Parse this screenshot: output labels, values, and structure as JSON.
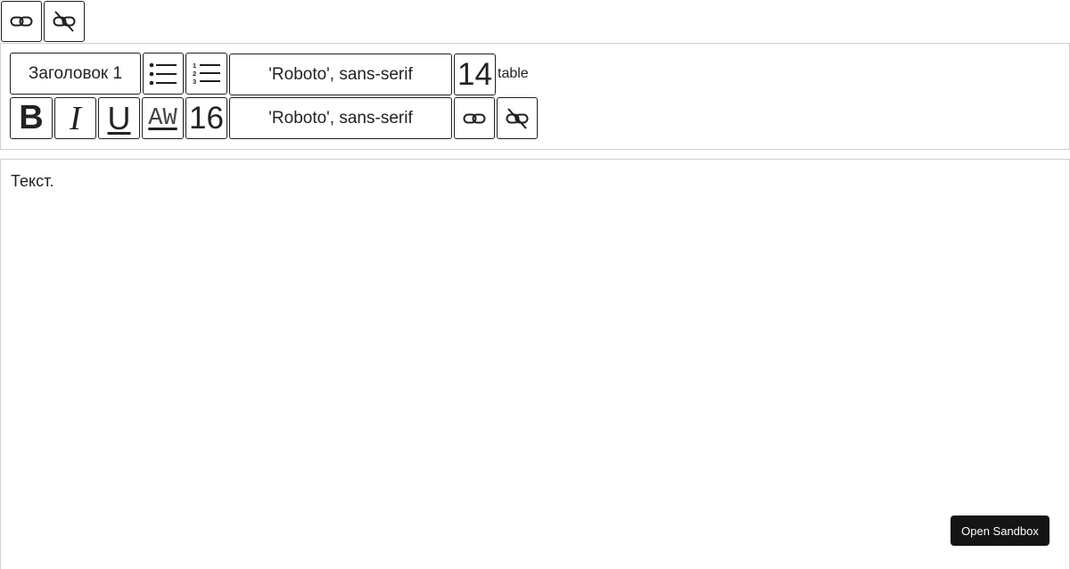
{
  "top_toolbar": {
    "link_icon": "link-icon",
    "unlink_icon": "unlink-icon"
  },
  "toolbar": {
    "heading_select": "Заголовок 1",
    "bullet_list_icon": "bullet-list-icon",
    "numbered_list_icon": "numbered-list-icon",
    "numbered_list_digits": [
      "1",
      "2",
      "3"
    ],
    "font_family_1": "'Roboto', sans-serif",
    "font_size_1": "14",
    "table_label": "table",
    "bold_label": "B",
    "italic_label": "I",
    "underline_label": "U",
    "text_color_label": "AW",
    "font_size_2": "16",
    "font_family_2": "'Roboto', sans-serif",
    "link_icon": "link-icon",
    "unlink_icon": "unlink-icon"
  },
  "editor": {
    "content": "Текст."
  },
  "sandbox_button": "Open Sandbox"
}
